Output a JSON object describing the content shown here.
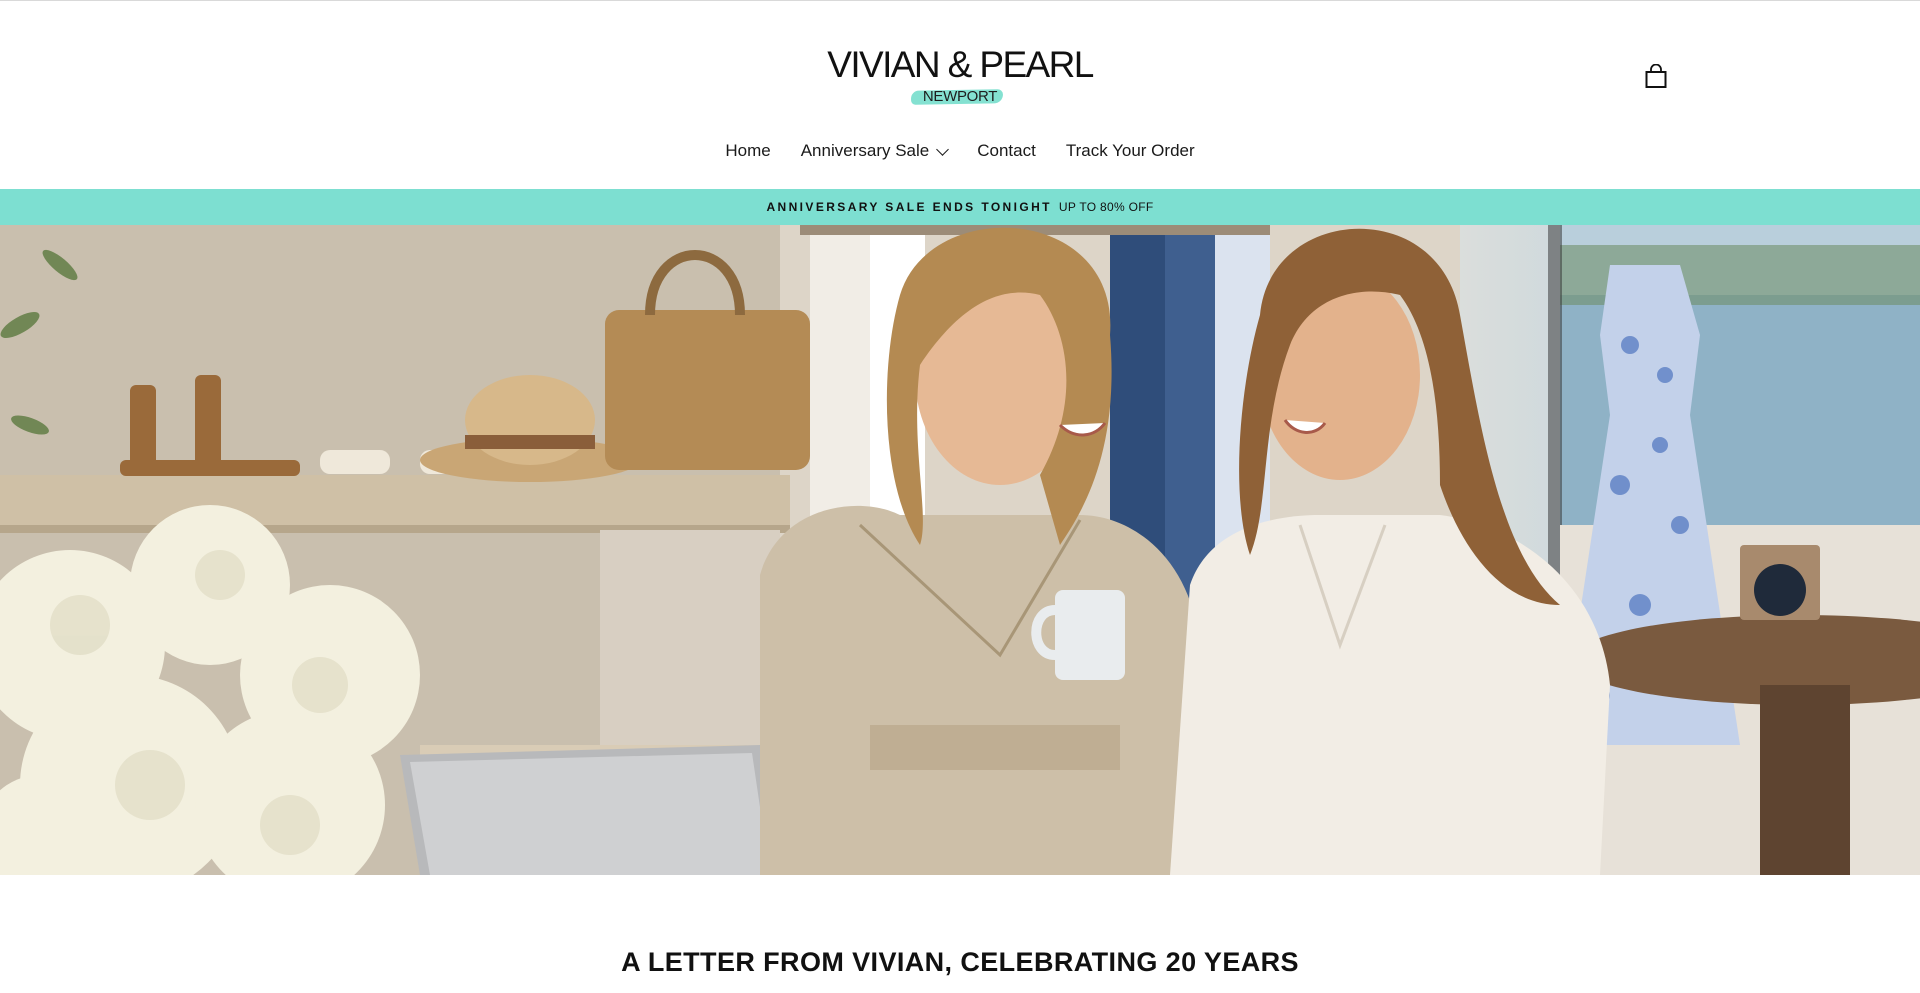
{
  "brand": {
    "name": "VIVIAN & PEARL",
    "location": "NEWPORT",
    "accent_color": "#7ddfd1"
  },
  "header": {
    "cart_icon": "shopping-bag-icon"
  },
  "nav": {
    "items": [
      {
        "label": "Home"
      },
      {
        "label": "Anniversary Sale",
        "dropdown_icon": "chevron-down-icon"
      },
      {
        "label": "Contact"
      },
      {
        "label": "Track Your Order"
      }
    ]
  },
  "announcement": {
    "headline": "ANNIVERSARY SALE ENDS TONIGHT",
    "detail": "UP TO 80% OFF"
  },
  "hero": {
    "image": "boutique-owners-photo"
  },
  "letter": {
    "title": "A LETTER FROM VIVIAN, CELEBRATING 20 YEARS"
  }
}
